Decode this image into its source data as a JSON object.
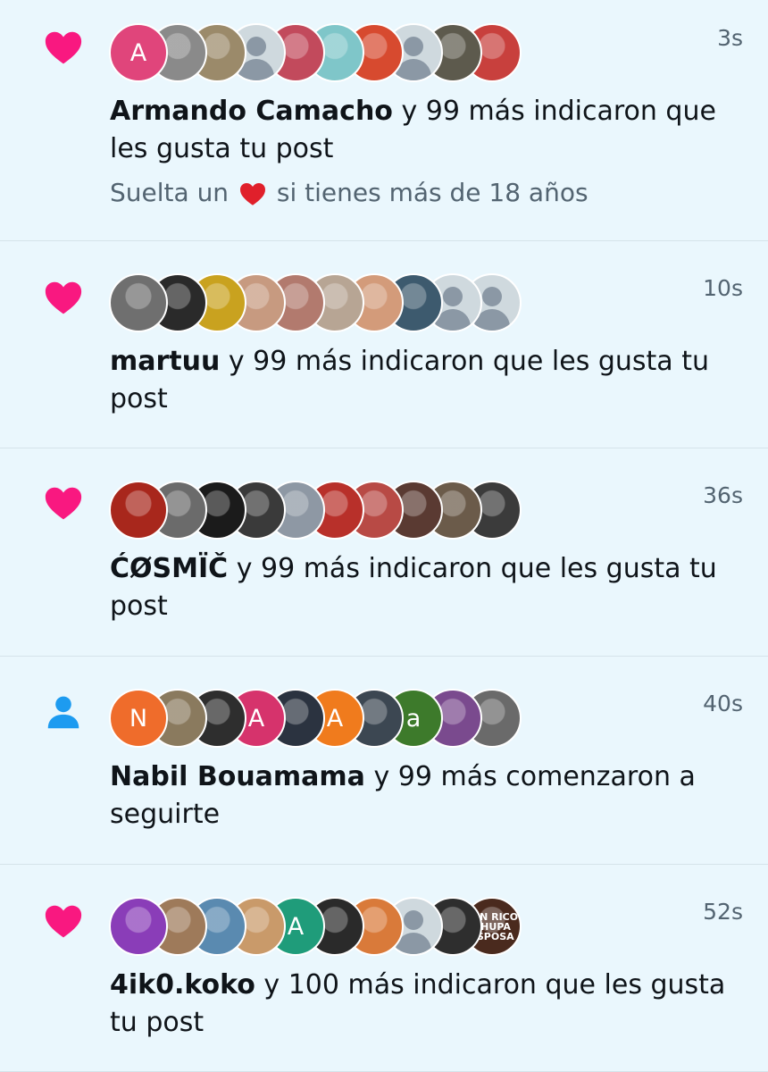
{
  "colors": {
    "background": "#eaf7fd",
    "like_heart": "#f91880",
    "follow_icon": "#1d9bf0",
    "secondary_text": "#536471",
    "divider": "#d5e3ea"
  },
  "notifications": [
    {
      "type": "like",
      "icon": "heart-icon",
      "time": "3s",
      "name": "Armando Camacho",
      "rest": " y 99 más indicaron que les gusta tu post",
      "subtext_before": "Suelta un ",
      "subtext_emoji": "red-heart-emoji",
      "subtext_after": " si tienes más de 18 años",
      "avatars": [
        {
          "kind": "letter",
          "letter": "A",
          "color": "#e0457b"
        },
        {
          "kind": "photo",
          "icon": "avatar-image",
          "color": "#8a8a8a",
          "text": ""
        },
        {
          "kind": "photo",
          "icon": "avatar-image",
          "color": "#9b8a6a"
        },
        {
          "kind": "default",
          "icon": "default-avatar-icon"
        },
        {
          "kind": "photo",
          "icon": "avatar-image",
          "color": "#c24a5c"
        },
        {
          "kind": "photo",
          "icon": "avatar-image",
          "color": "#7fc6c9"
        },
        {
          "kind": "photo",
          "icon": "avatar-image",
          "color": "#d74a2f"
        },
        {
          "kind": "default",
          "icon": "default-avatar-icon"
        },
        {
          "kind": "photo",
          "icon": "avatar-image",
          "color": "#5d5a4d"
        },
        {
          "kind": "photo",
          "icon": "avatar-image",
          "color": "#c8403d"
        }
      ]
    },
    {
      "type": "like",
      "icon": "heart-icon",
      "time": "10s",
      "name": "martuu",
      "rest": " y 99 más indicaron que les gusta tu post",
      "avatars": [
        {
          "kind": "photo",
          "icon": "avatar-image",
          "color": "#6f6f6f"
        },
        {
          "kind": "photo",
          "icon": "avatar-image",
          "color": "#2a2a2a"
        },
        {
          "kind": "photo",
          "icon": "avatar-image",
          "color": "#c9a21f"
        },
        {
          "kind": "photo",
          "icon": "avatar-image",
          "color": "#c79a80"
        },
        {
          "kind": "photo",
          "icon": "avatar-image",
          "color": "#b27a6e"
        },
        {
          "kind": "photo",
          "icon": "avatar-image",
          "color": "#b7a594"
        },
        {
          "kind": "photo",
          "icon": "avatar-image",
          "color": "#d39b7a"
        },
        {
          "kind": "photo",
          "icon": "avatar-image",
          "color": "#3d5a6e"
        },
        {
          "kind": "default",
          "icon": "default-avatar-icon"
        },
        {
          "kind": "default",
          "icon": "default-avatar-icon"
        }
      ]
    },
    {
      "type": "like",
      "icon": "heart-icon",
      "time": "36s",
      "name": "ĆØSMÏČ",
      "rest": " y 99 más indicaron que les gusta tu post",
      "avatars": [
        {
          "kind": "photo",
          "icon": "avatar-image",
          "color": "#a8271c"
        },
        {
          "kind": "photo",
          "icon": "avatar-image",
          "color": "#6b6b6b"
        },
        {
          "kind": "photo",
          "icon": "avatar-image",
          "color": "#1b1b1b"
        },
        {
          "kind": "photo",
          "icon": "avatar-image",
          "color": "#3a3a3a"
        },
        {
          "kind": "photo",
          "icon": "avatar-image",
          "color": "#8e98a4"
        },
        {
          "kind": "photo",
          "icon": "avatar-image",
          "color": "#b8302a"
        },
        {
          "kind": "photo",
          "icon": "avatar-image",
          "color": "#b84a45"
        },
        {
          "kind": "photo",
          "icon": "avatar-image",
          "color": "#5a3a32"
        },
        {
          "kind": "photo",
          "icon": "avatar-image",
          "color": "#6b5b4a"
        },
        {
          "kind": "photo",
          "icon": "avatar-image",
          "color": "#3b3b3b"
        }
      ]
    },
    {
      "type": "follow",
      "icon": "person-icon",
      "time": "40s",
      "name": "Nabil Bouamama",
      "rest": " y 99 más comenzaron a seguirte",
      "avatars": [
        {
          "kind": "letter",
          "letter": "N",
          "color": "#ef6c2b"
        },
        {
          "kind": "photo",
          "icon": "avatar-image",
          "color": "#8a7a5e"
        },
        {
          "kind": "photo",
          "icon": "avatar-image",
          "color": "#2e2e2e"
        },
        {
          "kind": "letter",
          "letter": "A",
          "color": "#d6336c"
        },
        {
          "kind": "photo",
          "icon": "avatar-image",
          "color": "#2b3340"
        },
        {
          "kind": "letter",
          "letter": "A",
          "color": "#f07b1d"
        },
        {
          "kind": "photo",
          "icon": "avatar-image",
          "color": "#3c4752"
        },
        {
          "kind": "letter",
          "letter": "a",
          "color": "#3d7a2b"
        },
        {
          "kind": "photo",
          "icon": "avatar-image",
          "color": "#7a4a8e"
        },
        {
          "kind": "photo",
          "icon": "avatar-image",
          "color": "#6a6a6a"
        }
      ]
    },
    {
      "type": "like",
      "icon": "heart-icon",
      "time": "52s",
      "name": "4ik0.koko",
      "rest": " y 100 más indicaron que les gusta tu post",
      "avatars": [
        {
          "kind": "photo",
          "icon": "avatar-image",
          "color": "#8a3db8"
        },
        {
          "kind": "photo",
          "icon": "avatar-image",
          "color": "#9e7a5a"
        },
        {
          "kind": "photo",
          "icon": "avatar-image",
          "color": "#5a8ab0"
        },
        {
          "kind": "photo",
          "icon": "avatar-image",
          "color": "#c99a6a"
        },
        {
          "kind": "letter",
          "letter": "A",
          "color": "#1f9c7a"
        },
        {
          "kind": "photo",
          "icon": "avatar-image",
          "color": "#2a2a2a"
        },
        {
          "kind": "photo",
          "icon": "avatar-image",
          "color": "#d97a3a"
        },
        {
          "kind": "default",
          "icon": "default-avatar-icon"
        },
        {
          "kind": "photo",
          "icon": "avatar-image",
          "color": "#2e2e2e"
        },
        {
          "kind": "photo",
          "icon": "avatar-image",
          "color": "#4a2a1e",
          "text": "TAN RICO CHUPA ESPOSA"
        }
      ]
    }
  ]
}
